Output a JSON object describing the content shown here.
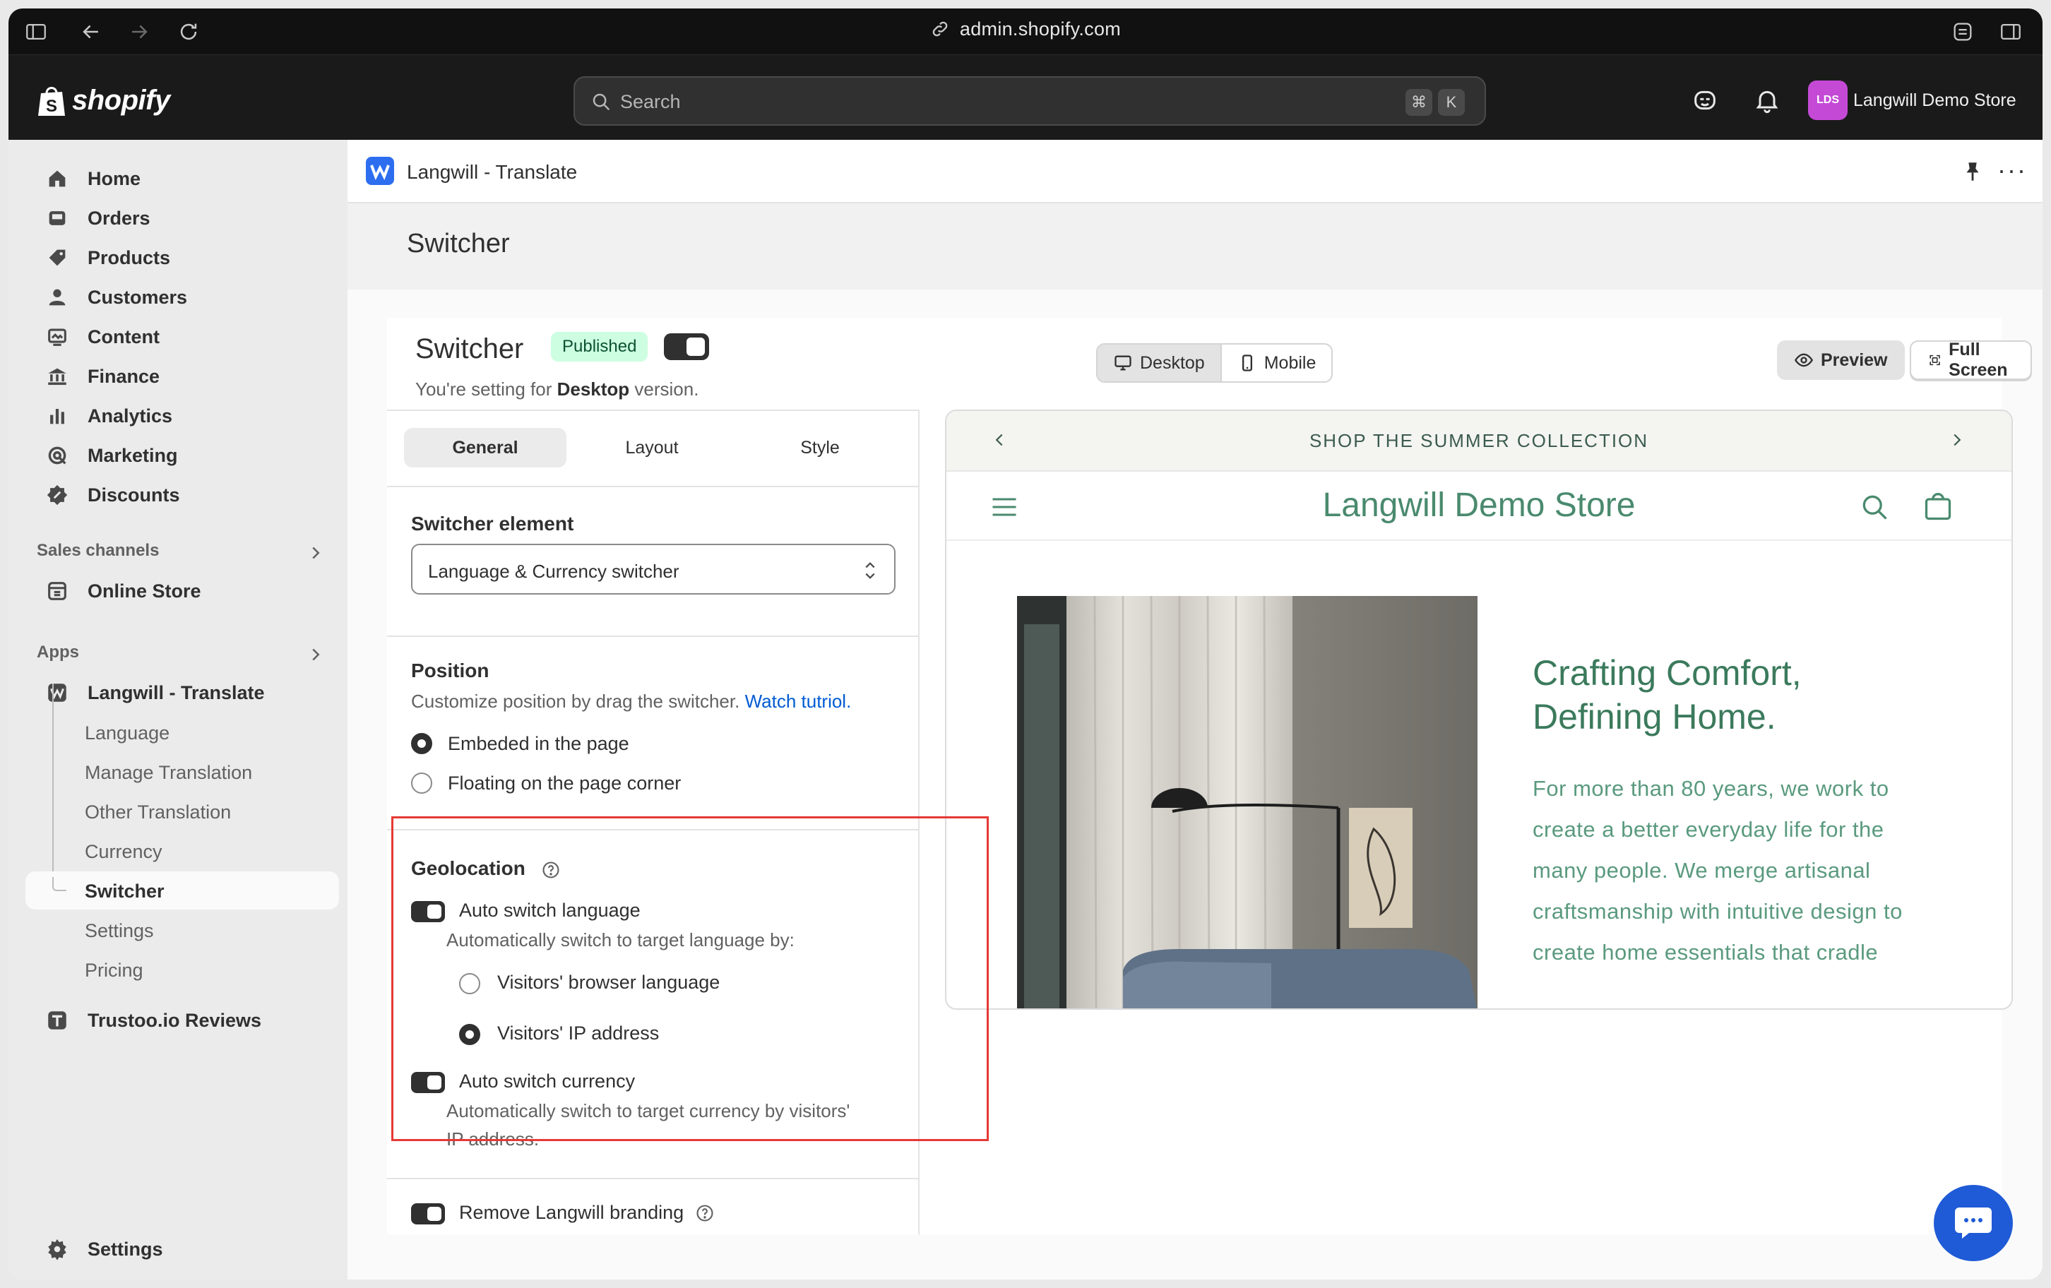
{
  "browser": {
    "url": "admin.shopify.com"
  },
  "topbar": {
    "logo_text": "shopify",
    "search_placeholder": "Search",
    "shortcut_keys": [
      "⌘",
      "K"
    ],
    "store_initials": "LDS",
    "store_name": "Langwill Demo Store"
  },
  "sidebar": {
    "items": [
      {
        "label": "Home",
        "icon": "home-icon"
      },
      {
        "label": "Orders",
        "icon": "inbox-icon"
      },
      {
        "label": "Products",
        "icon": "tag-icon"
      },
      {
        "label": "Customers",
        "icon": "person-icon"
      },
      {
        "label": "Content",
        "icon": "content-icon"
      },
      {
        "label": "Finance",
        "icon": "bank-icon"
      },
      {
        "label": "Analytics",
        "icon": "bar-chart-icon"
      },
      {
        "label": "Marketing",
        "icon": "target-icon"
      },
      {
        "label": "Discounts",
        "icon": "discount-icon"
      }
    ],
    "sales_channels_label": "Sales channels",
    "online_store_label": "Online Store",
    "apps_label": "Apps",
    "app_name": "Langwill - Translate",
    "app_subitems": [
      "Language",
      "Manage Translation",
      "Other Translation",
      "Currency",
      "Switcher",
      "Settings",
      "Pricing"
    ],
    "other_app": "Trustoo.io Reviews",
    "settings_label": "Settings"
  },
  "appbar": {
    "title": "Langwill - Translate"
  },
  "page": {
    "title": "Switcher"
  },
  "card": {
    "title": "Switcher",
    "status_badge": "Published",
    "subtitle_prefix": "You're setting for ",
    "subtitle_bold": "Desktop",
    "subtitle_suffix": " version.",
    "view_modes": [
      "Desktop",
      "Mobile"
    ],
    "preview_button": "Preview",
    "fullscreen_button": "Full Screen"
  },
  "panel": {
    "tabs": [
      "General",
      "Layout",
      "Style"
    ],
    "switcher_element": {
      "title": "Switcher element",
      "value": "Language & Currency switcher"
    },
    "position": {
      "title": "Position",
      "description": "Customize position by drag the switcher. ",
      "link": "Watch tutriol.",
      "options": [
        "Embeded in the page",
        "Floating on the page corner"
      ],
      "selected": 0
    },
    "geolocation": {
      "title": "Geolocation",
      "auto_language_label": "Auto switch language",
      "auto_language_desc": "Automatically switch to target language by:",
      "language_options": [
        "Visitors' browser language",
        "Visitors' IP address"
      ],
      "language_selected": 1,
      "auto_currency_label": "Auto switch currency",
      "auto_currency_desc_1": "Automatically switch to target currency by visitors'",
      "auto_currency_desc_2": "IP address."
    },
    "branding_label": "Remove Langwill branding"
  },
  "preview": {
    "announcement": "SHOP THE SUMMER COLLECTION",
    "store_name": "Langwill Demo Store",
    "hero_heading_1": "Crafting Comfort,",
    "hero_heading_2": "Defining Home.",
    "hero_text": "For more than 80 years, we work to create a better everyday life for the many people. We merge artisanal craftsmanship with intuitive design to create home essentials that cradle"
  },
  "colors": {
    "accent": "#303030",
    "published_bg": "#cdfee1",
    "store_green": "#4a8a6e",
    "highlight": "#e53935",
    "chat": "#1f5bd6"
  }
}
